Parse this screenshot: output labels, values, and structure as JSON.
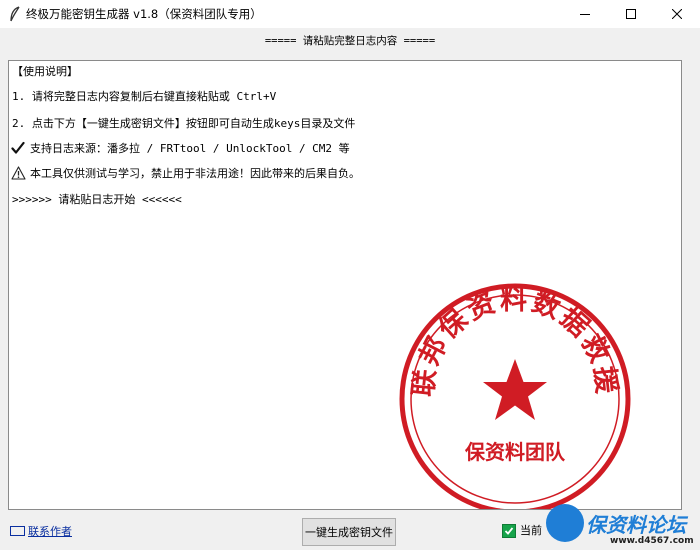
{
  "window": {
    "title": "终极万能密钥生成器 v1.8（保资料团队专用）",
    "app_icon": "feather-icon",
    "controls": [
      "minimize-icon",
      "maximize-icon",
      "close-icon"
    ]
  },
  "header": {
    "label": "===== 请粘贴完整日志内容 ====="
  },
  "log_text": {
    "line1": "【使用说明】",
    "line2": "1. 请将完整日志内容复制后右键直接粘贴或 Ctrl+V",
    "line3": "2. 点击下方【一键生成密钥文件】按钮即可自动生成keys目录及文件",
    "line4": "支持日志来源：潘多拉 / FRTtool / UnlockTool / CM2 等",
    "line5": "本工具仅供测试与学习，禁止用于非法用途！因此带来的后果自负。",
    "line6": ">>>>>> 请粘贴日志开始 <<<<<<"
  },
  "stamp": {
    "arc_text": "联邦保资料数据救援",
    "bottom_text": "保资料团队",
    "color": "#d01c24"
  },
  "footer": {
    "contact_label": "联系作者",
    "generate_button": "一键生成密钥文件",
    "checkbox_label": "当前",
    "checkbox_checked": true
  },
  "watermark": {
    "text": "保资料论坛",
    "url": "www.d4567.com",
    "color": "#1f7ed6"
  }
}
